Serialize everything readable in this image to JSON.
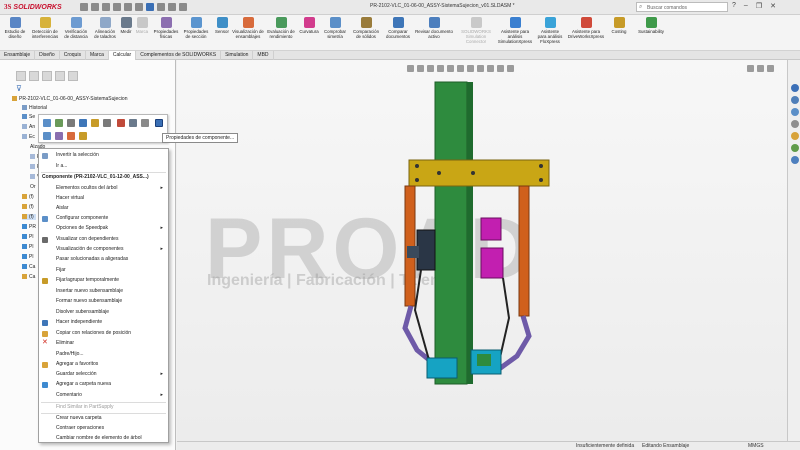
{
  "titlebar": {
    "app_name": "SOLIDWORKS",
    "document_title": "PR-2102-VLC_01-06-00_ASSY-SistemaSujecion_v01.SLDASM *",
    "search_placeholder": "Buscar comandos"
  },
  "ribbon": {
    "buttons": [
      "Estudio de diseño",
      "Detección de interferencias",
      "Verificación de distancia",
      "Alineación de taladros",
      "Medir",
      "Marca",
      "Propiedades físicas",
      "Propiedades de sección",
      "Sensor",
      "Visualización de ensamblajes",
      "Evaluación de rendimiento",
      "Curvatura",
      "Comprobar simetría",
      "Comparación de sólidos",
      "Comparar documentos",
      "Revisar documento activo",
      "SOLIDWORKS Simulation Connector",
      "Asistente para análisis SimulationXpress",
      "Asistente para análisis FloXpress",
      "Asistente para DriveWorksXpress",
      "Costing",
      "Sustainability"
    ]
  },
  "tabs": [
    "Ensamblaje",
    "Diseño",
    "Croquis",
    "Marca",
    "Calcular",
    "Complementos de SOLIDWORKS",
    "Simulation",
    "MBD"
  ],
  "active_tab": "Calcular",
  "tree": {
    "root": "PR-2102-VLC_01-06-00_ASSY-SistemaSujecion",
    "history": "Historial",
    "fragments": [
      "Se",
      "An",
      "Ec",
      "Alzado",
      "Pl",
      "Pl",
      "Vi",
      "Or",
      "(f)",
      "(f)",
      "(f)",
      "PR",
      "Pl",
      "Pl",
      "Pl",
      "Ca",
      "Ca"
    ]
  },
  "tooltip": "Propiedades de componente...",
  "context_menu": {
    "items": [
      {
        "label": "Invertir la selección",
        "disabled": false,
        "submenu": false,
        "icon": "invert-selection-icon"
      },
      {
        "label": "Ir a...",
        "disabled": false,
        "submenu": false,
        "icon": ""
      },
      {
        "label": "Componente (PR-2102-VLC_01-12-00_ASS...)",
        "disabled": false,
        "submenu": false,
        "header": true
      },
      {
        "label": "Elementos ocultos del árbol",
        "disabled": false,
        "submenu": true,
        "icon": ""
      },
      {
        "label": "Hacer virtual",
        "disabled": false,
        "submenu": false,
        "icon": ""
      },
      {
        "label": "Aislar",
        "disabled": false,
        "submenu": false,
        "icon": ""
      },
      {
        "label": "Configurar componente",
        "disabled": false,
        "submenu": false,
        "icon": "configure-icon"
      },
      {
        "label": "Opciones de Speedpak",
        "disabled": false,
        "submenu": true,
        "icon": ""
      },
      {
        "label": "Visualizar con dependientes",
        "disabled": false,
        "submenu": false,
        "icon": "dependents-icon"
      },
      {
        "label": "Visualización de componentes",
        "disabled": false,
        "submenu": true,
        "icon": ""
      },
      {
        "label": "Pasar solucionadas a aligeradas",
        "disabled": false,
        "submenu": false,
        "icon": ""
      },
      {
        "label": "Fijar",
        "disabled": false,
        "submenu": false,
        "icon": ""
      },
      {
        "label": "Fijar/agrupar temporalmente",
        "disabled": false,
        "submenu": false,
        "icon": "fix-temporarily-icon"
      },
      {
        "label": "Insertar nuevo subensamblaje",
        "disabled": false,
        "submenu": false,
        "icon": ""
      },
      {
        "label": "Formar nuevo subensamblaje",
        "disabled": false,
        "submenu": false,
        "icon": ""
      },
      {
        "label": "Disolver subensamblaje",
        "disabled": false,
        "submenu": false,
        "icon": ""
      },
      {
        "label": "Hacer independiente",
        "disabled": false,
        "submenu": false,
        "icon": "make-independent-icon"
      },
      {
        "label": "Copiar con relaciones de posición",
        "disabled": false,
        "submenu": false,
        "icon": "copy-mates-icon"
      },
      {
        "label": "Eliminar",
        "disabled": false,
        "submenu": false,
        "icon": "delete-icon"
      },
      {
        "label": "Padre/Hijo...",
        "disabled": false,
        "submenu": false,
        "icon": ""
      },
      {
        "label": "Agregar a favoritos",
        "disabled": false,
        "submenu": false,
        "icon": "favorite-icon"
      },
      {
        "label": "Guardar selección",
        "disabled": false,
        "submenu": true,
        "icon": ""
      },
      {
        "label": "Agregar a carpeta nueva",
        "disabled": false,
        "submenu": false,
        "icon": "folder-icon"
      },
      {
        "label": "Comentario",
        "disabled": false,
        "submenu": true,
        "icon": ""
      },
      {
        "label": "Find Similar in PartSupply",
        "disabled": true,
        "submenu": false,
        "icon": ""
      },
      {
        "label": "Crear nueva carpeta",
        "disabled": false,
        "submenu": false,
        "icon": ""
      },
      {
        "label": "Contraer operaciones",
        "disabled": false,
        "submenu": false,
        "icon": ""
      },
      {
        "label": "Cambiar nombre de elemento de árbol",
        "disabled": false,
        "submenu": false,
        "icon": ""
      }
    ]
  },
  "watermark": {
    "logo": "PROAD",
    "tagline": "Ingeniería | Fabricación | Talento"
  },
  "statusbar": {
    "definition": "Insuficientemente definida",
    "mode": "Editando Ensamblaje",
    "units": "MMGS"
  },
  "colors": {
    "column_green": "#2e8b3e",
    "band_yellow": "#c9a615",
    "arm_orange": "#d0601c",
    "link_purple": "#6e5aa8",
    "clamp_magenta": "#c21fb0",
    "block_cyan": "#16a3c3",
    "gripper_dark": "#2a3646"
  }
}
